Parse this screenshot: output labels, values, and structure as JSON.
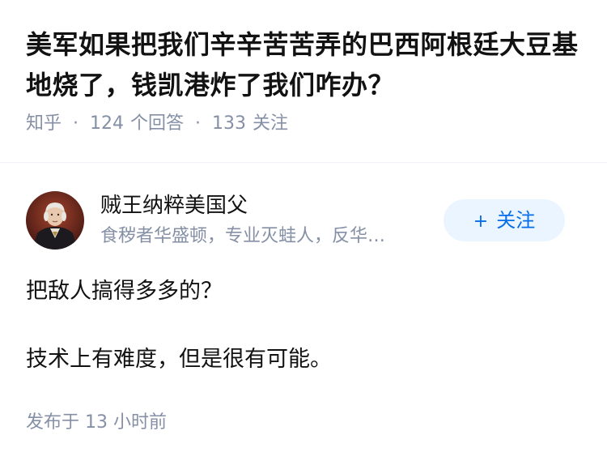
{
  "question": {
    "title": "美军如果把我们辛辛苦苦弄的巴西阿根廷大豆基地烧了，钱凯港炸了我们咋办？",
    "source": "知乎",
    "answer_count": "124",
    "answer_label": "个回答",
    "follower_count": "133",
    "follower_label": "关注"
  },
  "author": {
    "name": "贼王纳粹美国父",
    "bio": "食秽者华盛顿，专业灭蛙人，反华…",
    "follow_label": "关注",
    "follow_plus": "+"
  },
  "answer": {
    "paragraphs": [
      "把敌人搞得多多的？",
      "技术上有难度，但是很有可能。"
    ]
  },
  "meta": {
    "published_prefix": "发布于",
    "published_time": "13 小时前"
  },
  "colors": {
    "primary_text": "#121212",
    "secondary_text": "#8590a6",
    "follow_bg": "#ebf5ff",
    "follow_text": "#056de8"
  }
}
